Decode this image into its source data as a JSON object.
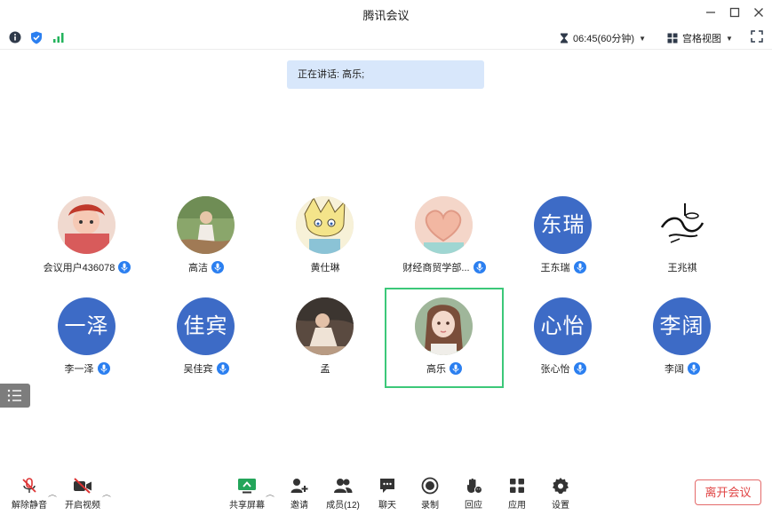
{
  "window": {
    "title": "腾讯会议"
  },
  "infobar": {
    "timer": "06:45(60分钟)",
    "view_mode": "宫格视图"
  },
  "speaking": {
    "text": "正在讲话: 高乐;"
  },
  "participants": [
    {
      "name": "会议用户436078",
      "avatar_text": "",
      "mic": true
    },
    {
      "name": "高洁",
      "avatar_text": "",
      "mic": true
    },
    {
      "name": "黄仕琳",
      "avatar_text": "",
      "mic": false
    },
    {
      "name": "财经商贸学部...",
      "avatar_text": "",
      "mic": true
    },
    {
      "name": "王东瑞",
      "avatar_text": "东瑞",
      "mic": true
    },
    {
      "name": "王兆祺",
      "avatar_text": "",
      "mic": false
    },
    {
      "name": "李一泽",
      "avatar_text": "一泽",
      "mic": true
    },
    {
      "name": "吴佳宾",
      "avatar_text": "佳宾",
      "mic": true
    },
    {
      "name": "孟",
      "avatar_text": "",
      "mic": false
    },
    {
      "name": "高乐",
      "avatar_text": "",
      "mic": true,
      "active": true
    },
    {
      "name": "张心怡",
      "avatar_text": "心怡",
      "mic": true
    },
    {
      "name": "李阔",
      "avatar_text": "李阔",
      "mic": true
    }
  ],
  "toolbar": {
    "unmute": "解除静音",
    "start_video": "开启视频",
    "share_screen": "共享屏幕",
    "invite": "邀请",
    "members": "成员(12)",
    "chat": "聊天",
    "record": "录制",
    "reactions": "回应",
    "apps": "应用",
    "settings": "设置",
    "leave": "离开会议"
  },
  "colors": {
    "accent_blue": "#2b7ff0",
    "avatar_blue": "#3d6bc6",
    "active_border": "#3cc879",
    "leave_red": "#e04545"
  }
}
